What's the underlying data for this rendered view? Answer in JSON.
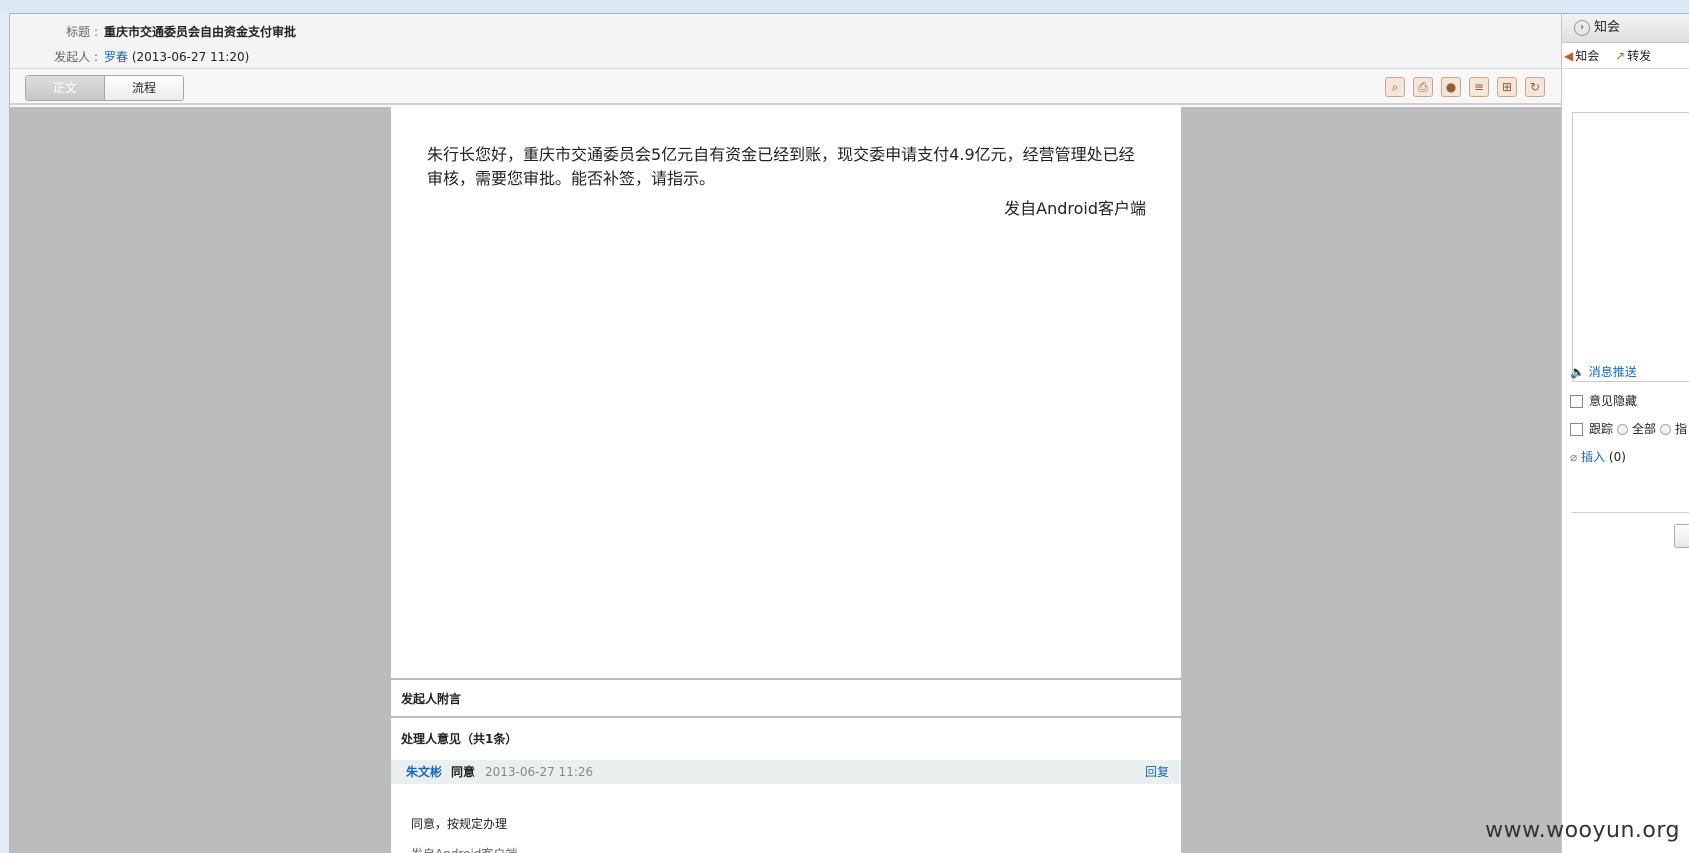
{
  "header": {
    "title_label": "标题 :",
    "title_value": "重庆市交通委员会自由资金支付审批",
    "sender_label": "发起人 :",
    "sender_name": "罗春",
    "sender_time": " (2013-06-27 11:20)"
  },
  "tabs": [
    {
      "label": "正文",
      "active": true
    },
    {
      "label": "流程",
      "active": false
    }
  ],
  "toolbar_icons": [
    "zoom-icon",
    "print-icon",
    "record-icon",
    "document-icon",
    "export-icon",
    "refresh-icon"
  ],
  "doc": {
    "body": "朱行长您好，重庆市交通委员会5亿元自有资金已经到账，现交委申请支付4.9亿元，经营管理处已经审核，需要您审批。能否补签，请指示。",
    "signature": "发自Android客户端"
  },
  "sections": {
    "sender_note": "发起人附言",
    "handler_opinions": "处理人意见（共1条）"
  },
  "opinion": {
    "name": "朱文彬",
    "action": "同意",
    "time": "2013-06-27 11:26",
    "reply": "回复",
    "text": "同意，按规定办理",
    "text2": "发自Android客户端"
  },
  "right_panel": {
    "header": "知会",
    "action_notify": "知会",
    "action_forward": "转发",
    "message_push": "消息推送",
    "hide_opinion": "意见隐藏",
    "track": "跟踪",
    "track_all": "全部",
    "track_specific": "指",
    "insert": "插入",
    "insert_count": "(0)"
  },
  "watermark": "www.wooyun.org"
}
